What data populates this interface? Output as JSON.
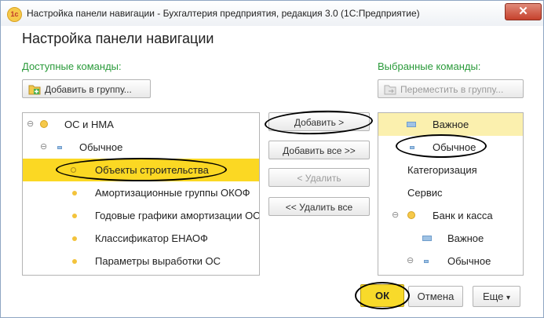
{
  "window": {
    "app_icon": "1c-logo-icon",
    "app_icon_text": "1с",
    "title": "Настройка панели навигации - Бухгалтерия предприятия, редакция 3.0  (1С:Предприятие)",
    "close_label": "✕"
  },
  "heading": "Настройка панели навигации",
  "available": {
    "label": "Доступные команды:",
    "add_to_group": "Добавить в группу...",
    "add_to_group_icon": "folder-add-icon",
    "items": [
      {
        "text": "ОС и НМА",
        "collapse": "⊖",
        "icon": "yellow-circle-icon"
      },
      {
        "text": "Обычное",
        "collapse": "⊖",
        "icon": "blue-rect-icon"
      },
      {
        "text": "Объекты строительства",
        "icon": "circle-outline-icon"
      },
      {
        "text": "Амортизационные группы ОКОФ",
        "icon": "yellow-dot-icon"
      },
      {
        "text": "Годовые графики амортизации ОС",
        "icon": "yellow-dot-icon"
      },
      {
        "text": "Классификатор ЕНАОФ",
        "icon": "yellow-dot-icon"
      },
      {
        "text": "Параметры выработки ОС",
        "icon": "yellow-dot-icon"
      }
    ]
  },
  "actions": {
    "add": "Добавить >",
    "add_all": "Добавить все >>",
    "remove": "< Удалить",
    "remove_all": "<< Удалить все"
  },
  "selected": {
    "label": "Выбранные команды:",
    "move_to_group": "Переместить в группу...",
    "move_to_group_icon": "folder-move-icon",
    "items": [
      {
        "text": "Важное",
        "icon": "blue-rect-icon"
      },
      {
        "text": "Обычное",
        "icon": "blue-rect-small-icon"
      },
      {
        "text": "Категоризация"
      },
      {
        "text": "Сервис"
      },
      {
        "text": "Банк и касса",
        "collapse": "⊖",
        "icon": "yellow-circle-icon"
      },
      {
        "text": "Важное",
        "icon": "blue-rect-icon"
      },
      {
        "text": "Обычное",
        "collapse": "⊖",
        "icon": "blue-rect-small-icon"
      }
    ]
  },
  "footer": {
    "ok": "ОК",
    "cancel": "Отмена",
    "more": "Еще",
    "more_arrow": "▾"
  },
  "colors": {
    "selection_yellow": "#fbd823",
    "selection_light": "#fbf0ae",
    "label_green": "#2a9a3a",
    "ok_yellow": "#f8da2a"
  }
}
